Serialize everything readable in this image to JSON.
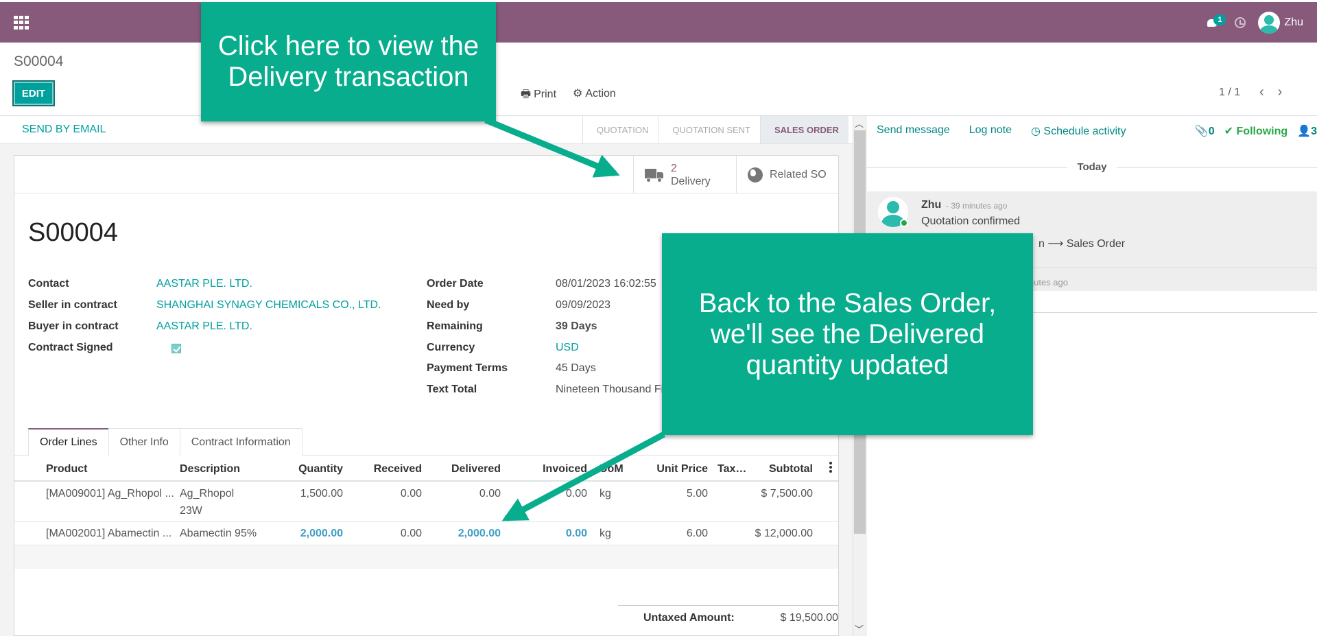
{
  "navbar": {
    "apps_icon": "apps-grid-icon",
    "chat_count": "1",
    "user_name": "Zhu"
  },
  "control_panel": {
    "breadcrumb": "S00004",
    "edit_label": "EDIT",
    "print_label": "Print",
    "action_label": "Action",
    "pager": "1 / 1"
  },
  "statusbar": {
    "send_email": "SEND BY EMAIL",
    "stages": [
      "QUOTATION",
      "QUOTATION SENT",
      "SALES ORDER"
    ],
    "active_stage": "SALES ORDER"
  },
  "smart_buttons": {
    "delivery_count": "2",
    "delivery_label": "Delivery",
    "related_label": "Related SO"
  },
  "form": {
    "title": "S00004",
    "left_fields": [
      {
        "label": "Contact",
        "value": "AASTAR PLE. LTD."
      },
      {
        "label": "Seller in contract",
        "value": "SHANGHAI SYNAGY CHEMICALS CO., LTD."
      },
      {
        "label": "Buyer in contract",
        "value": "AASTAR PLE. LTD."
      },
      {
        "label": "Contract Signed",
        "value": "checked"
      }
    ],
    "right_fields": [
      {
        "label": "Order Date",
        "value": "08/01/2023 16:02:55"
      },
      {
        "label": "Need by",
        "value": "09/09/2023"
      },
      {
        "label": "Remaining",
        "value": "39 Days"
      },
      {
        "label": "Currency",
        "value": "USD"
      },
      {
        "label": "Payment Terms",
        "value": "45 Days"
      },
      {
        "label": "Text Total",
        "value": "Nineteen Thousand Fi"
      }
    ]
  },
  "tabs": [
    "Order Lines",
    "Other Info",
    "Contract Information"
  ],
  "table": {
    "columns": [
      "Product",
      "Description",
      "Quantity",
      "Received",
      "Delivered",
      "Invoiced",
      "UoM",
      "Unit Price",
      "Tax…",
      "Subtotal"
    ],
    "rows": [
      {
        "product": "[MA009001] Ag_Rhopol ...",
        "description_1": "Ag_Rhopol",
        "description_2": "23W",
        "quantity": "1,500.00",
        "received": "0.00",
        "delivered": "0.00",
        "invoiced": "0.00",
        "uom": "kg",
        "unit_price": "5.00",
        "subtotal": "$ 7,500.00"
      },
      {
        "product": "[MA002001] Abamectin ...",
        "description_1": "Abamectin 95%",
        "quantity": "2,000.00",
        "received": "0.00",
        "delivered": "2,000.00",
        "invoiced": "0.00",
        "uom": "kg",
        "unit_price": "6.00",
        "subtotal": "$ 12,000.00"
      }
    ],
    "untaxed_label": "Untaxed Amount:",
    "untaxed_value": "$ 19,500.00"
  },
  "chatter": {
    "send_message": "Send message",
    "log_note": "Log note",
    "schedule_activity": "Schedule activity",
    "attachments": "0",
    "following": "Following",
    "followers": "3",
    "today": "Today",
    "author": "Zhu",
    "time": "- 39 minutes ago",
    "body": "Quotation confirmed",
    "tracking": "n ⟶ Sales Order",
    "time2": "inutes ago"
  },
  "callouts": {
    "delivery": "Click here to view the\nDelivery transaction",
    "sales_order": "Back to the Sales Order,\nwe'll see the Delivered\nquantity updated"
  },
  "colors": {
    "brand": "#875a7b",
    "accent": "#00a09d",
    "callout": "#07ad8d"
  }
}
